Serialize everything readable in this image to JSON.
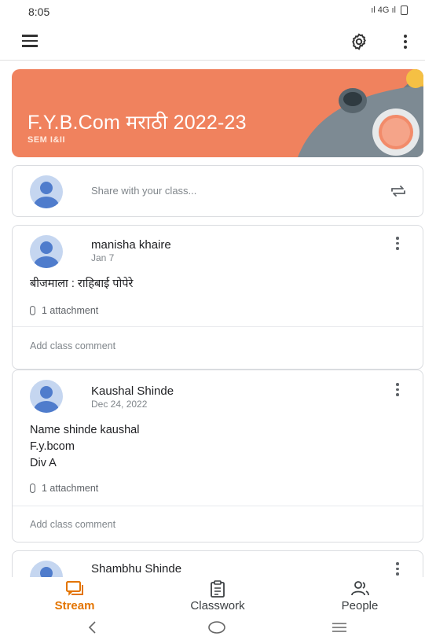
{
  "status": {
    "time": "8:05",
    "network": "ıl 4G ıl"
  },
  "app_bar": {
    "menu_icon": "menu-icon",
    "settings_icon": "settings-icon",
    "more_icon": "more-vert-icon"
  },
  "banner": {
    "title": "F.Y.B.Com मराठी 2022-23",
    "subtitle": "SEM I&II",
    "color": "#f0825e"
  },
  "share": {
    "placeholder": "Share with your class..."
  },
  "posts": [
    {
      "author": "manisha khaire",
      "date": "Jan 7",
      "body": [
        "बीजमाला : राहिबाई पोपेरे"
      ],
      "attachments": "1 attachment",
      "comment": "Add class comment"
    },
    {
      "author": "Kaushal Shinde",
      "date": "Dec 24, 2022",
      "body": [
        "Name shinde kaushal",
        "F.y.bcom",
        "Div A"
      ],
      "attachments": "1 attachment",
      "comment": "Add class comment"
    },
    {
      "author": "Shambhu Shinde"
    }
  ],
  "bottom_nav": {
    "items": [
      {
        "label": "Stream",
        "icon": "stream-icon",
        "active": true
      },
      {
        "label": "Classwork",
        "icon": "classwork-icon",
        "active": false
      },
      {
        "label": "People",
        "icon": "people-icon",
        "active": false
      }
    ],
    "accent": "#e37400"
  }
}
